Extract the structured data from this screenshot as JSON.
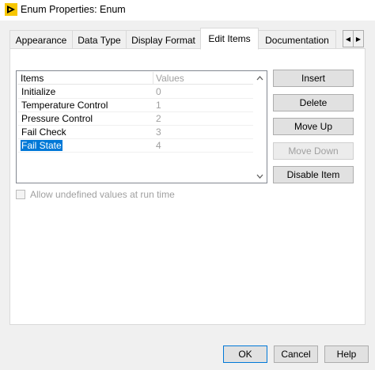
{
  "window": {
    "title": "Enum Properties: Enum",
    "icon": "labview-vi-icon"
  },
  "tabs": [
    {
      "label": "Appearance"
    },
    {
      "label": "Data Type"
    },
    {
      "label": "Display Format"
    },
    {
      "label": "Edit Items",
      "active": true
    },
    {
      "label": "Documentation"
    }
  ],
  "tab_scroll": {
    "left_icon": "chevron-left-icon",
    "right_icon": "chevron-right-icon"
  },
  "list": {
    "header_items": "Items",
    "header_values": "Values",
    "rows": [
      {
        "name": "Initialize",
        "value": "0"
      },
      {
        "name": "Temperature Control",
        "value": "1"
      },
      {
        "name": "Pressure Control",
        "value": "2"
      },
      {
        "name": "Fail Check",
        "value": "3"
      },
      {
        "name": "Fail State",
        "value": "4",
        "selected": true
      }
    ]
  },
  "buttons": {
    "insert": "Insert",
    "delete": "Delete",
    "move_up": "Move Up",
    "move_down": "Move Down",
    "disable_item": "Disable Item"
  },
  "allow_undefined": {
    "label": "Allow undefined values at run time",
    "checked": false,
    "enabled": false
  },
  "footer": {
    "ok": "OK",
    "cancel": "Cancel",
    "help": "Help"
  },
  "colors": {
    "selection": "#0078d7",
    "panel_bg": "#f0f0f0"
  }
}
